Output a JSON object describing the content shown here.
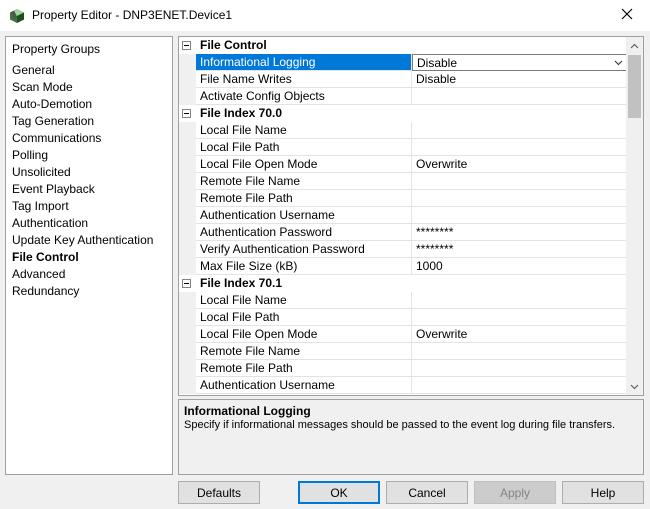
{
  "window": {
    "title": "Property Editor - DNP3ENET.Device1"
  },
  "icons": {
    "app": "property-editor-app-icon",
    "close": "close-icon",
    "dropdown": "chevron-down-icon",
    "scroll_up": "scroll-up-arrow",
    "scroll_down": "scroll-down-arrow"
  },
  "groups": {
    "title": "Property Groups",
    "items": [
      {
        "label": "General"
      },
      {
        "label": "Scan Mode"
      },
      {
        "label": "Auto-Demotion"
      },
      {
        "label": "Tag Generation"
      },
      {
        "label": "Communications"
      },
      {
        "label": "Polling"
      },
      {
        "label": "Unsolicited"
      },
      {
        "label": "Event Playback"
      },
      {
        "label": "Tag Import"
      },
      {
        "label": "Authentication"
      },
      {
        "label": "Update Key Authentication"
      },
      {
        "label": "File Control",
        "selected": true
      },
      {
        "label": "Advanced"
      },
      {
        "label": "Redundancy"
      }
    ]
  },
  "grid": {
    "rows": [
      {
        "type": "category",
        "label": "File Control"
      },
      {
        "type": "property",
        "name": "Informational Logging",
        "value": "Disable",
        "selected": true
      },
      {
        "type": "property",
        "name": "File Name Writes",
        "value": "Disable"
      },
      {
        "type": "property",
        "name": "Activate Config Objects",
        "value": ""
      },
      {
        "type": "category",
        "label": "File Index 70.0"
      },
      {
        "type": "property",
        "name": "Local File Name",
        "value": ""
      },
      {
        "type": "property",
        "name": "Local File Path",
        "value": ""
      },
      {
        "type": "property",
        "name": "Local File Open Mode",
        "value": "Overwrite"
      },
      {
        "type": "property",
        "name": "Remote File Name",
        "value": ""
      },
      {
        "type": "property",
        "name": "Remote File Path",
        "value": ""
      },
      {
        "type": "property",
        "name": "Authentication Username",
        "value": ""
      },
      {
        "type": "property",
        "name": "Authentication Password",
        "value": "********"
      },
      {
        "type": "property",
        "name": "Verify Authentication Password",
        "value": "********"
      },
      {
        "type": "property",
        "name": "Max File Size (kB)",
        "value": "1000"
      },
      {
        "type": "category",
        "label": "File Index 70.1"
      },
      {
        "type": "property",
        "name": "Local File Name",
        "value": ""
      },
      {
        "type": "property",
        "name": "Local File Path",
        "value": ""
      },
      {
        "type": "property",
        "name": "Local File Open Mode",
        "value": "Overwrite"
      },
      {
        "type": "property",
        "name": "Remote File Name",
        "value": ""
      },
      {
        "type": "property",
        "name": "Remote File Path",
        "value": ""
      },
      {
        "type": "property",
        "name": "Authentication Username",
        "value": ""
      }
    ]
  },
  "description": {
    "title": "Informational Logging",
    "text": "Specify if informational messages should be passed to the event log during file transfers."
  },
  "buttons": {
    "defaults": "Defaults",
    "ok": "OK",
    "cancel": "Cancel",
    "apply": "Apply",
    "help": "Help"
  },
  "colors": {
    "selection": "#0078d7",
    "border": "#a0a0a0"
  }
}
